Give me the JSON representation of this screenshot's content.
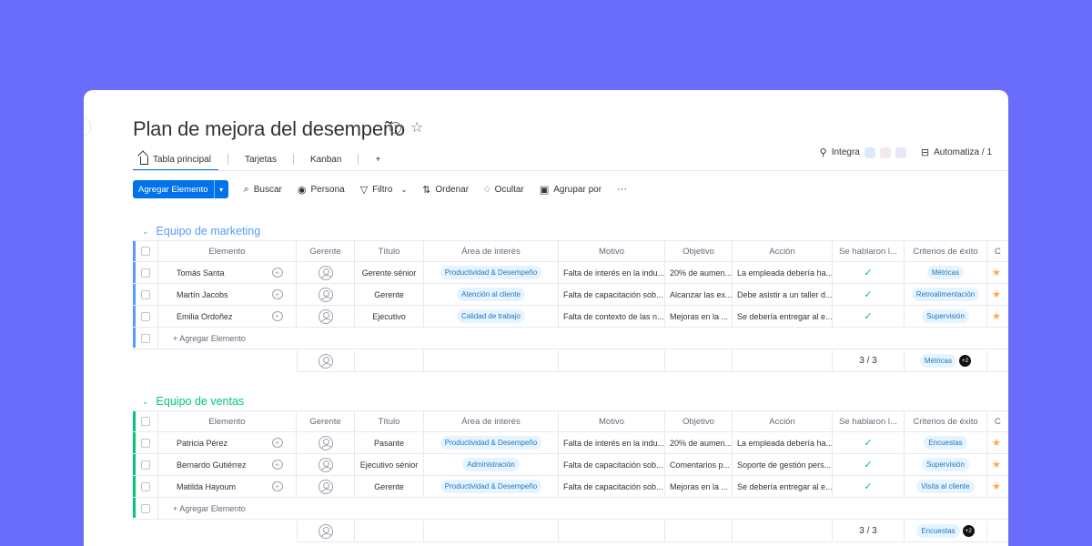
{
  "board": {
    "title": "Plan de mejora del desempeño",
    "info_icon": "info-icon",
    "favorite_icon": "star-icon"
  },
  "tabs": [
    {
      "label": "Tabla principal",
      "icon": "home-icon",
      "active": true
    },
    {
      "label": "Tarjetas"
    },
    {
      "label": "Kanban"
    },
    {
      "label": "+"
    }
  ],
  "right_tools": {
    "integrate_label": "Integra",
    "automate_label": "Automatiza / 1"
  },
  "toolbar": {
    "add_label": "Agregar Elemento",
    "search_label": "Buscar",
    "person_label": "Persona",
    "filter_label": "Filtro",
    "sort_label": "Ordenar",
    "hide_label": "Ocultar",
    "group_label": "Agrupar por",
    "more_label": "···"
  },
  "columns": [
    "Elemento",
    "Gerente",
    "Título",
    "Área de interés",
    "Motivo",
    "Objetivo",
    "Acción",
    "Se hablaron l...",
    "Criterios de éxito",
    "C"
  ],
  "groups": [
    {
      "title": "Equipo de marketing",
      "color": "#579bfc",
      "add_item_label": "+ Agregar Elemento",
      "rows": [
        {
          "name": "Tomás Santa",
          "title": "Gerente sénior",
          "area": "Productividad & Desempeño",
          "motivo": "Falta de interés en la indu...",
          "objetivo": "20% de aumen...",
          "accion": "La empleada debería ha...",
          "criterio": "Métricas"
        },
        {
          "name": "Martín Jacobs",
          "title": "Gerente",
          "area": "Atención al cliente",
          "motivo": "Falta de capacitación sob...",
          "objetivo": "Alcanzar las ex...",
          "accion": "Debe asistir a un taller d...",
          "criterio": "Retroalimentación"
        },
        {
          "name": "Emilia Ordoñez",
          "title": "Ejecutivo",
          "area": "Calidad de trabajo",
          "motivo": "Falta de contexto de las n...",
          "objetivo": "Mejoras en la ...",
          "accion": "Se debería entregar al e...",
          "criterio": "Supervisión"
        }
      ],
      "summary": {
        "count": "3 / 3",
        "criterio": "Métricas",
        "more": "+2"
      }
    },
    {
      "title": "Equipo de ventas",
      "color": "#00c875",
      "add_item_label": "+ Agregar Elemento",
      "rows": [
        {
          "name": "Patricia Pérez",
          "title": "Pasante",
          "area": "Productividad & Desempeño",
          "motivo": "Falta de interés en la indu...",
          "objetivo": "20% de aumen...",
          "accion": "La empleada debería ha...",
          "criterio": "Encuestas"
        },
        {
          "name": "Bernardo Gutiérrez",
          "title": "Ejecutivo sénior",
          "area": "Administración",
          "motivo": "Falta de capacitación sob...",
          "objetivo": "Comentarios p...",
          "accion": "Soporte de gestión pers...",
          "criterio": "Supervisión"
        },
        {
          "name": "Matilda Hayoum",
          "title": "Gerente",
          "area": "Productividad & Desempeño",
          "motivo": "Falta de capacitación sob...",
          "objetivo": "Mejoras en la ...",
          "accion": "Se debería entregar al e...",
          "criterio": "Visita al cliente"
        }
      ],
      "summary": {
        "count": "3 / 3",
        "criterio": "Encuestas",
        "more": "+2"
      }
    }
  ]
}
